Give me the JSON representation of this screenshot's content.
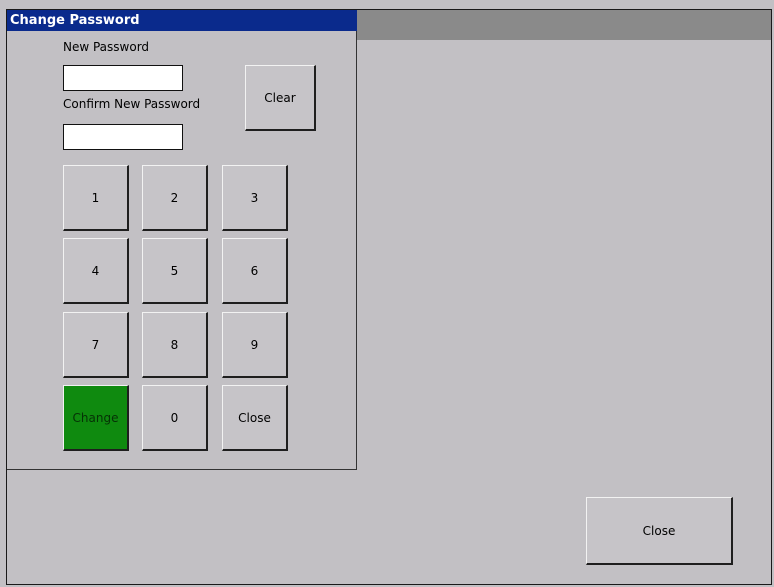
{
  "dialog": {
    "title": "Change Password",
    "new_password_label": "New Password",
    "new_password_value": "",
    "confirm_label": "Confirm New Password",
    "confirm_value": "",
    "clear_label": "Clear",
    "keypad": {
      "k1": "1",
      "k2": "2",
      "k3": "3",
      "k4": "4",
      "k5": "5",
      "k6": "6",
      "k7": "7",
      "k8": "8",
      "k9": "9",
      "change": "Change",
      "k0": "0",
      "close": "Close"
    }
  },
  "main": {
    "close_label": "Close"
  },
  "colors": {
    "title_bar": "#0a2a8c",
    "change_button": "#0f8a0f",
    "background": "#c2c0c4"
  }
}
